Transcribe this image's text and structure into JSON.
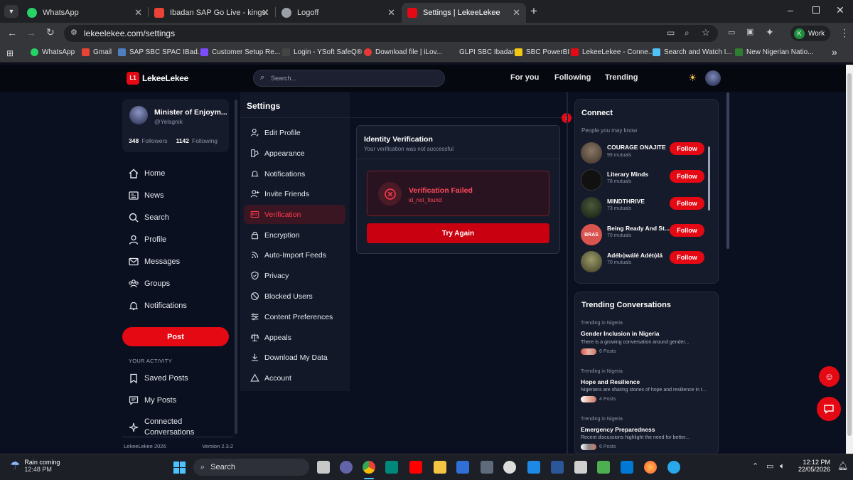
{
  "browser": {
    "tabs": [
      {
        "title": "WhatsApp",
        "active": false
      },
      {
        "title": "Ibadan SAP Go Live - kingsley.a",
        "active": false
      },
      {
        "title": "Logoff",
        "active": false
      },
      {
        "title": "Settings | LekeeLekee",
        "active": true
      }
    ],
    "new_tab_icon": "plus-icon",
    "url": "lekeelekee.com/settings",
    "profile_label": "Work",
    "profile_initial": "K",
    "bookmarks": [
      "WhatsApp",
      "Gmail",
      "SAP SBC SPAC IBad...",
      "Customer Setup Re...",
      "Login - YSoft SafeQ®",
      "Download file | iLov...",
      "GLPI SBC Ibadan",
      "SBC PowerBI",
      "LekeeLekee - Conne...",
      "Search and Watch I...",
      "New Nigerian Natio..."
    ],
    "more_bookmarks": "»"
  },
  "site": {
    "brand": "LekeeLekee",
    "brand_badge": "L1",
    "search_placeholder": "Search...",
    "nav": [
      "For you",
      "Following",
      "Trending"
    ],
    "accent_color": "#e50914"
  },
  "profile": {
    "name": "Minister of Enjoym...",
    "handle": "@Yelsgnik",
    "followers_count": "348",
    "followers_label": "Followers",
    "following_count": "1142",
    "following_label": "Following"
  },
  "sidebar": {
    "items": [
      {
        "label": "Home",
        "icon": "home-icon"
      },
      {
        "label": "News",
        "icon": "news-icon"
      },
      {
        "label": "Search",
        "icon": "search-icon"
      },
      {
        "label": "Profile",
        "icon": "user-icon"
      },
      {
        "label": "Messages",
        "icon": "mail-icon"
      },
      {
        "label": "Groups",
        "icon": "groups-icon"
      },
      {
        "label": "Notifications",
        "icon": "bell-icon"
      }
    ],
    "post_label": "Post",
    "section_label": "YOUR ACTIVITY",
    "activity": [
      {
        "label": "Saved Posts",
        "icon": "bookmark-icon"
      },
      {
        "label": "My Posts",
        "icon": "chat-icon"
      },
      {
        "label": "Connected Conversations",
        "icon": "sparkle-icon"
      }
    ],
    "footer_left": "LekeeLekee 2026",
    "footer_right": "Version 2.3.2"
  },
  "settings": {
    "title": "Settings",
    "items": [
      {
        "label": "Edit Profile",
        "icon": "user-edit-icon"
      },
      {
        "label": "Appearance",
        "icon": "palette-icon"
      },
      {
        "label": "Notifications",
        "icon": "bell-icon"
      },
      {
        "label": "Invite Friends",
        "icon": "user-plus-icon"
      },
      {
        "label": "Verification",
        "icon": "id-card-icon",
        "active": true
      },
      {
        "label": "Encryption",
        "icon": "lock-icon"
      },
      {
        "label": "Auto-Import Feeds",
        "icon": "feed-icon"
      },
      {
        "label": "Privacy",
        "icon": "shield-icon"
      },
      {
        "label": "Blocked Users",
        "icon": "block-icon"
      },
      {
        "label": "Content Preferences",
        "icon": "sliders-icon"
      },
      {
        "label": "Appeals",
        "icon": "scale-icon"
      },
      {
        "label": "Download My Data",
        "icon": "download-icon"
      },
      {
        "label": "Account",
        "icon": "warning-icon"
      }
    ]
  },
  "verification": {
    "title": "Identity Verification",
    "subtitle": "Your verification was not successful",
    "status_title": "Verification Failed",
    "status_code": "id_not_found",
    "retry_label": "Try Again"
  },
  "connect": {
    "title": "Connect",
    "subtitle": "People you may know",
    "follow_label": "Follow",
    "people": [
      {
        "name": "COURAGE ONAJITE",
        "mutuals": "99 mutuals",
        "color": "#5a4a3a"
      },
      {
        "name": "Literary Minds",
        "mutuals": "78 mutuals",
        "color": "#222222"
      },
      {
        "name": "MINDTHRIVE",
        "mutuals": "73 mutuals",
        "color": "#2b3a2b"
      },
      {
        "name": "Being Ready And St...",
        "mutuals": "70 mutuals",
        "color": "#d9534f",
        "badge": "BRAS"
      },
      {
        "name": "Adébọ̀wálé Adétọ̀lá",
        "mutuals": "70 mutuals",
        "color": "#6b6b4a"
      }
    ]
  },
  "trending": {
    "title": "Trending Conversations",
    "items": [
      {
        "context": "Trending in Nigeria",
        "title": "Gender Inclusion in Nigeria",
        "excerpt": "There is a growing conversation around gender...",
        "posts": "6 Posts"
      },
      {
        "context": "Trending in Nigeria",
        "title": "Hope and Resilience",
        "excerpt": "Nigerians are sharing stories of hope and resilience in t...",
        "posts": "4 Posts"
      },
      {
        "context": "Trending in Nigeria",
        "title": "Emergency Preparedness",
        "excerpt": "Recent discussions highlight the need for better...",
        "posts": "6 Posts"
      }
    ]
  },
  "taskbar": {
    "weather_title": "Rain coming",
    "weather_time": "12:48 PM",
    "search_label": "Search",
    "clock_time": "12:12 PM",
    "clock_date": "22/05/2026"
  }
}
